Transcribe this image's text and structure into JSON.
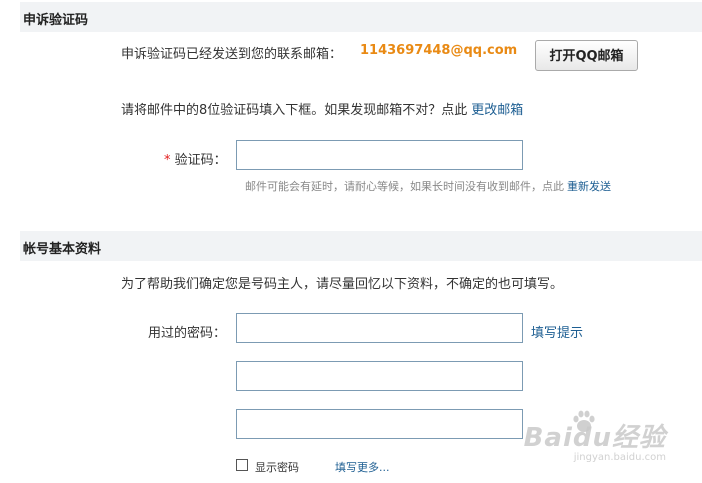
{
  "appeal_section": {
    "title": "申诉验证码",
    "sent_text": "申诉验证码已经发送到您的联系邮箱：",
    "email": "1143697448@qq.com",
    "open_mail_button": "打开QQ邮箱",
    "instruction": "请将邮件中的8位验证码填入下框。如果发现邮箱不对？点此",
    "change_email_link": "更改邮箱",
    "required_mark": "*",
    "code_label": "验证码：",
    "code_value": "",
    "delay_hint": "邮件可能会有延时，请耐心等候，如果长时间没有收到邮件，点此",
    "resend_link": "重新发送"
  },
  "account_section": {
    "title": "帐号基本资料",
    "description": "为了帮助我们确定您是号码主人，请尽量回忆以下资料，不确定的也可填写。",
    "password_label": "用过的密码：",
    "password_1": "",
    "password_2": "",
    "password_3": "",
    "fill_hint_link": "填写提示",
    "show_password_label": "显示密码",
    "show_password_checked": false,
    "fill_more_link": "填写更多..."
  },
  "watermark": {
    "logo_text": "Baidu经验",
    "url_text": "jingyan.baidu.com"
  },
  "colors": {
    "section_bg": "#f1f3f5",
    "email": "#e98a14",
    "link": "#1d5e92",
    "input_border": "#7c9bb3",
    "required": "#e21b1b"
  }
}
